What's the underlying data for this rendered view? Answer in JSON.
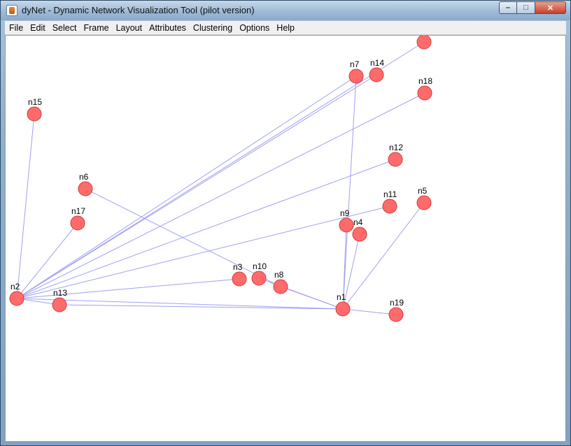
{
  "window": {
    "title": "dyNet - Dynamic Network Visualization Tool (pilot version)",
    "minimize_label": "–",
    "maximize_label": "□",
    "close_label": "✕"
  },
  "menu": [
    {
      "label": "File"
    },
    {
      "label": "Edit"
    },
    {
      "label": "Select"
    },
    {
      "label": "Frame"
    },
    {
      "label": "Layout"
    },
    {
      "label": "Attributes"
    },
    {
      "label": "Clustering"
    },
    {
      "label": "Options"
    },
    {
      "label": "Help"
    }
  ],
  "graph": {
    "node_color": "#ff6b6b",
    "node_stroke": "#d23a3a",
    "edge_color": "#a0a0f0",
    "nodes": [
      {
        "id": "n1",
        "label": "n1"
      },
      {
        "id": "n2",
        "label": "n2"
      },
      {
        "id": "n3",
        "label": "n3"
      },
      {
        "id": "n4",
        "label": "n4"
      },
      {
        "id": "n5",
        "label": "n5"
      },
      {
        "id": "n6",
        "label": "n6"
      },
      {
        "id": "n7",
        "label": "n7"
      },
      {
        "id": "n8",
        "label": "n8"
      },
      {
        "id": "n9",
        "label": "n9"
      },
      {
        "id": "n10",
        "label": "n10"
      },
      {
        "id": "n11",
        "label": "n11"
      },
      {
        "id": "n12",
        "label": "n12"
      },
      {
        "id": "n13",
        "label": "n13"
      },
      {
        "id": "n14",
        "label": "n14"
      },
      {
        "id": "n15",
        "label": "n15"
      },
      {
        "id": "n17",
        "label": "n17"
      },
      {
        "id": "n18",
        "label": "n18"
      },
      {
        "id": "n19",
        "label": "n19"
      },
      {
        "id": "n20",
        "label": ""
      }
    ],
    "edges": [
      [
        "n2",
        "n15"
      ],
      [
        "n2",
        "n17"
      ],
      [
        "n2",
        "n13"
      ],
      [
        "n2",
        "n1"
      ],
      [
        "n2",
        "n3"
      ],
      [
        "n2",
        "n12"
      ],
      [
        "n2",
        "n11"
      ],
      [
        "n2",
        "n18"
      ],
      [
        "n2",
        "n7"
      ],
      [
        "n2",
        "n14"
      ],
      [
        "n2",
        "n20"
      ],
      [
        "n13",
        "n1"
      ],
      [
        "n1",
        "n19"
      ],
      [
        "n1",
        "n5"
      ],
      [
        "n1",
        "n4"
      ],
      [
        "n1",
        "n9"
      ],
      [
        "n1",
        "n7"
      ],
      [
        "n1",
        "n8"
      ],
      [
        "n1",
        "n10"
      ],
      [
        "n6",
        "n8"
      ]
    ]
  }
}
